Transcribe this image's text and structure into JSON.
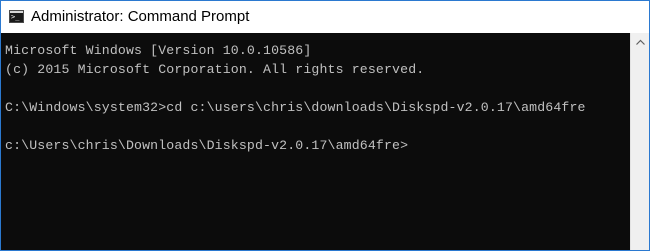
{
  "window": {
    "title": "Administrator: Command Prompt",
    "icon": "command-prompt-icon"
  },
  "console": {
    "lines": [
      "Microsoft Windows [Version 10.0.10586]",
      "(c) 2015 Microsoft Corporation. All rights reserved.",
      "",
      "C:\\Windows\\system32>cd c:\\users\\chris\\downloads\\Diskspd-v2.0.17\\amd64fre",
      "",
      "c:\\Users\\chris\\Downloads\\Diskspd-v2.0.17\\amd64fre>"
    ]
  },
  "colors": {
    "console_bg": "#0c0c0c",
    "console_text": "#c0c0c0",
    "titlebar_bg": "#ffffff",
    "border": "#2b79d0"
  }
}
